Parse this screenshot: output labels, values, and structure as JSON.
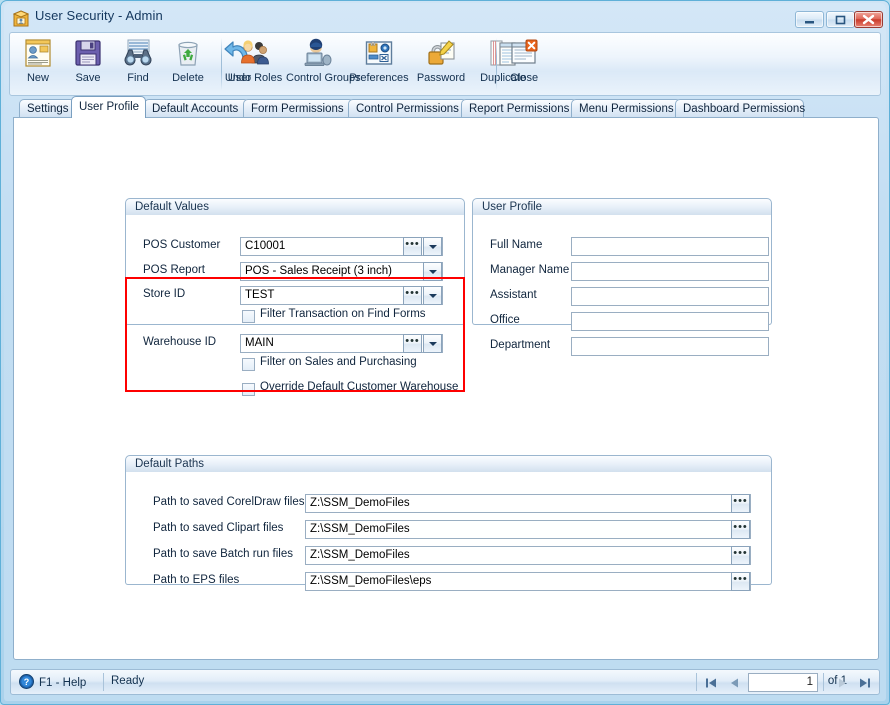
{
  "window": {
    "title": "User Security - Admin",
    "icon": "user-security-icon",
    "minimize_label": "",
    "maximize_label": "",
    "close_label": ""
  },
  "toolbar": {
    "groups": [
      {
        "items": [
          {
            "label": "New",
            "icon": "new-record-icon"
          },
          {
            "label": "Save",
            "icon": "floppy-disk-save-icon"
          },
          {
            "label": "Find",
            "icon": "binoculars-find-icon"
          },
          {
            "label": "Delete",
            "icon": "recycle-bin-delete-icon"
          },
          {
            "label": "Undo",
            "icon": "undo-arrow-icon"
          }
        ]
      },
      {
        "items": [
          {
            "label": "User Roles",
            "icon": "users-group-icon"
          },
          {
            "label": "Control Groups",
            "icon": "computer-user-icon"
          },
          {
            "label": "Preferences",
            "icon": "preferences-lock-icon"
          },
          {
            "label": "Password",
            "icon": "padlock-key-icon"
          },
          {
            "label": "Duplicate",
            "icon": "duplicate-pages-icon"
          }
        ]
      },
      {
        "items": [
          {
            "label": "Close",
            "icon": "close-window-icon"
          }
        ]
      }
    ]
  },
  "tabs": [
    {
      "label": "Settings",
      "active": false
    },
    {
      "label": "User Profile",
      "active": true
    },
    {
      "label": "Default Accounts",
      "active": false
    },
    {
      "label": "Form Permissions",
      "active": false
    },
    {
      "label": "Control Permissions",
      "active": false
    },
    {
      "label": "Report Permissions",
      "active": false
    },
    {
      "label": "Menu Permissions",
      "active": false
    },
    {
      "label": "Dashboard Permissions",
      "active": false
    }
  ],
  "default_values": {
    "title": "Default Values",
    "pos_customer": {
      "label": "POS Customer",
      "value": "C10001"
    },
    "pos_report": {
      "label": "POS Report",
      "value": "POS - Sales Receipt (3 inch)"
    },
    "store_id": {
      "label": "Store ID",
      "value": "TEST"
    },
    "warehouse_id": {
      "label": "Warehouse ID",
      "value": "MAIN"
    },
    "checkbox_filter_transaction": {
      "label": "Filter Transaction on Find Forms",
      "checked": false
    },
    "checkbox_filter_sales": {
      "label": "Filter on Sales and Purchasing",
      "checked": false
    },
    "checkbox_override_warehouse": {
      "label": "Override Default Customer Warehouse",
      "checked": false
    },
    "highlight_color": "#fe0000"
  },
  "user_profile": {
    "title": "User Profile",
    "fields": [
      {
        "label": "Full Name",
        "value": "",
        "placeholder": ""
      },
      {
        "label": "Manager Name",
        "value": "",
        "placeholder": ""
      },
      {
        "label": "Assistant",
        "value": "",
        "placeholder": ""
      },
      {
        "label": "Office",
        "value": "",
        "placeholder": ""
      },
      {
        "label": "Department",
        "value": "",
        "placeholder": ""
      }
    ]
  },
  "default_paths": {
    "title": "Default Paths",
    "rows": [
      {
        "label": "Path to saved CorelDraw files",
        "value": "Z:\\SSM_DemoFiles"
      },
      {
        "label": "Path to saved Clipart files",
        "value": "Z:\\SSM_DemoFiles"
      },
      {
        "label": "Path to save Batch run files",
        "value": "Z:\\SSM_DemoFiles"
      },
      {
        "label": "Path to EPS files",
        "value": "Z:\\SSM_DemoFiles\\eps"
      }
    ],
    "browse_icon": "ellipsis-browse-icon"
  },
  "statusbar": {
    "help_label": "F1 - Help",
    "help_icon": "question-mark-help-icon",
    "status": "Ready",
    "page_value": "1",
    "of_label": "of 1",
    "nav": {
      "first": "first-record-icon",
      "prev": "previous-record-icon",
      "next": "next-record-icon",
      "last": "last-record-icon"
    }
  }
}
